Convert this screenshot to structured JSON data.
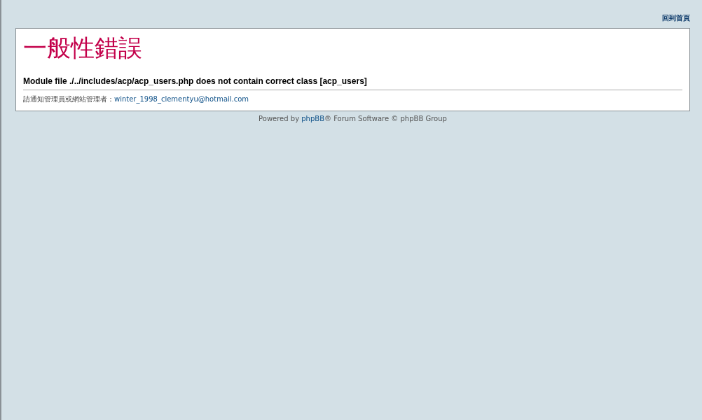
{
  "header": {
    "home_link": "回到首頁"
  },
  "error_panel": {
    "title": "一般性錯誤",
    "message": "Module file ./../includes/acp/acp_users.php does not contain correct class [acp_users]",
    "contact_prefix": "請通知管理員或網站管理者：",
    "contact_email": "winter_1998_clementyu@hotmail.com"
  },
  "footer": {
    "prefix": "Powered by ",
    "link": "phpBB",
    "suffix": "® Forum Software © phpBB Group"
  }
}
